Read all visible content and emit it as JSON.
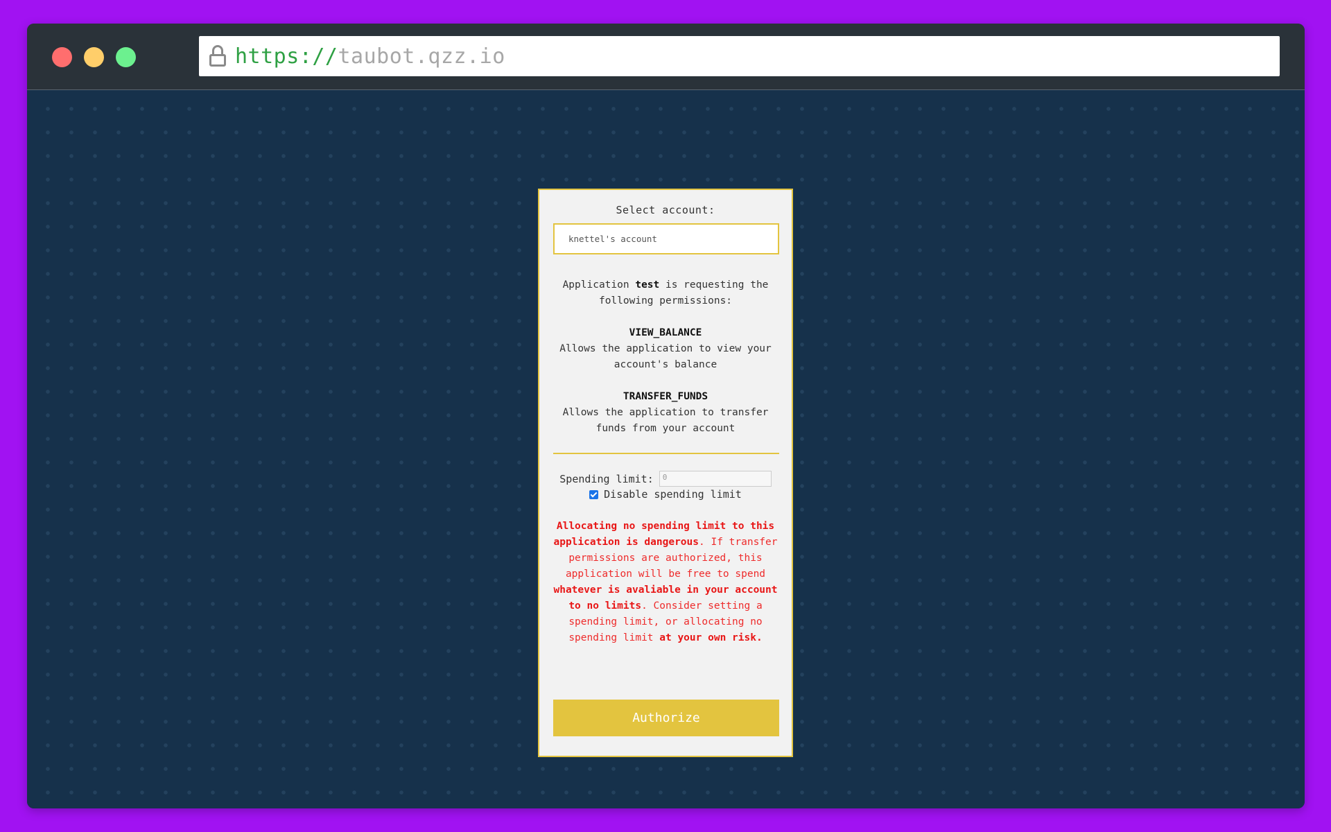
{
  "browser": {
    "url_scheme": "https://",
    "url_host": "taubot.qzz.io"
  },
  "auth_form": {
    "select_label": "Select account:",
    "selected_account": "knettel's account",
    "request_prefix": "Application ",
    "app_name": "test",
    "request_suffix": " is requesting the following permissions:",
    "permissions": [
      {
        "name": "VIEW_BALANCE",
        "description": "Allows the application to view your account's balance"
      },
      {
        "name": "TRANSFER_FUNDS",
        "description": "Allows the application to transfer funds from your account"
      }
    ],
    "spending_limit_label": "Spending limit:",
    "spending_limit_placeholder": "0",
    "disable_limit_label": "Disable spending limit",
    "disable_limit_checked": true,
    "warning": {
      "part1_bold": "Allocating no spending limit to this application is dangerous",
      "part2": ". If transfer permissions are authorized, this application will be free to spend ",
      "part3_bold": "whatever is avaliable in your account to no limits",
      "part4": ". Consider setting a spending limit, or allocating no spending limit ",
      "part5_bold": "at your own risk."
    },
    "authorize_label": "Authorize"
  },
  "colors": {
    "page_background": "#a112f2",
    "content_background": "#16314b",
    "accent": "#e3c43f",
    "warning": "#ee2b2b"
  }
}
